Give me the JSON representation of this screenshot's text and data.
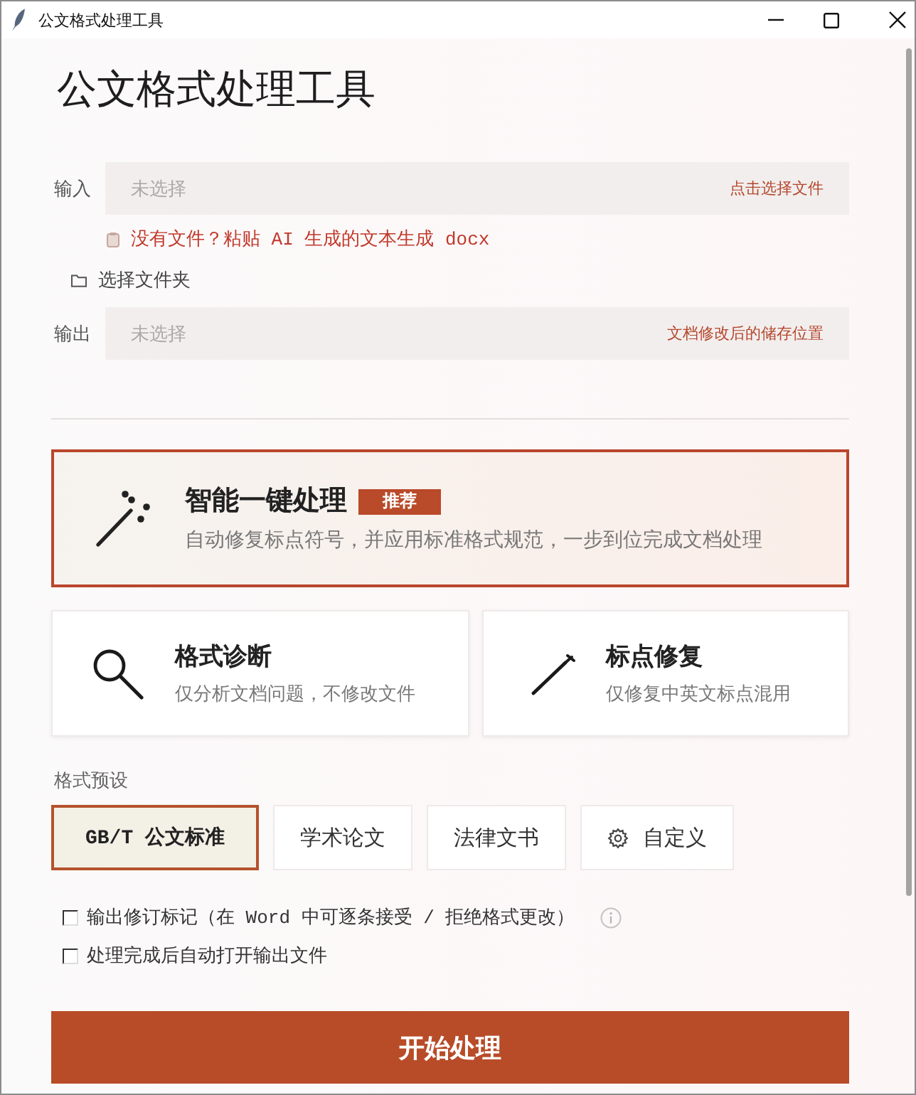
{
  "window": {
    "title": "公文格式处理工具"
  },
  "heading": "公文格式处理工具",
  "input": {
    "label": "输入",
    "placeholder": "未选择",
    "action": "点击选择文件"
  },
  "paste_link": "没有文件？粘贴 AI 生成的文本生成 docx",
  "folder_link": "选择文件夹",
  "output": {
    "label": "输出",
    "placeholder": "未选择",
    "action": "文档修改后的储存位置"
  },
  "modes": [
    {
      "kind": "smart",
      "title": "智能一键处理",
      "badge": "推荐",
      "description": "自动修复标点符号，并应用标准格式规范，一步到位完成文档处理"
    },
    {
      "kind": "diagnose",
      "title": "格式诊断",
      "description": "仅分析文档问题，不修改文件"
    },
    {
      "kind": "punctuation",
      "title": "标点修复",
      "description": "仅修复中英文标点混用"
    }
  ],
  "presets": {
    "label": "格式预设",
    "items": [
      {
        "label": "GB/T 公文标准",
        "selected": true,
        "kind": "standard"
      },
      {
        "label": "学术论文",
        "selected": false,
        "kind": "standard"
      },
      {
        "label": "法律文书",
        "selected": false,
        "kind": "standard"
      },
      {
        "label": "自定义",
        "selected": false,
        "kind": "custom"
      }
    ]
  },
  "options": [
    {
      "label": "输出修订标记（在 Word 中可逐条接受 / 拒绝格式更改）",
      "checked": false,
      "info": true
    },
    {
      "label": "处理完成后自动打开输出文件",
      "checked": false,
      "info": false
    }
  ],
  "start_button": "开始处理"
}
